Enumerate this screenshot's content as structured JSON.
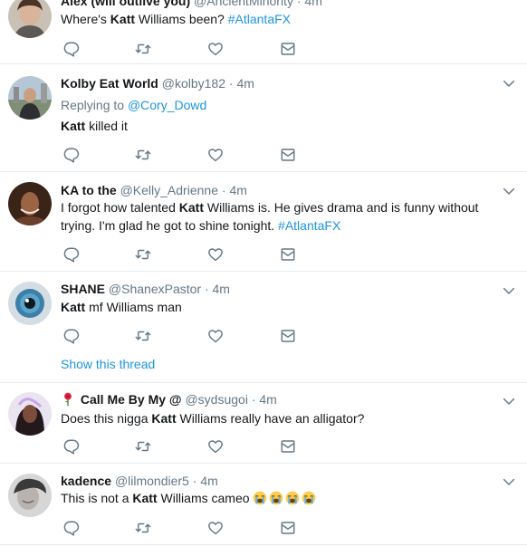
{
  "tweets": [
    {
      "name": "Alex (will outlive you)",
      "handle": "@AncientMinority",
      "time": "4m",
      "pre": "Where's ",
      "bold": "Katt",
      "post": " Williams been? ",
      "hashtag": "#AtlantaFX"
    },
    {
      "name": "Kolby Eat World",
      "handle": "@kolby182",
      "time": "4m",
      "replying_label": "Replying to",
      "replying_handle": "@Cory_Dowd",
      "bold": "Katt",
      "post": " killed it"
    },
    {
      "name": "KA to the",
      "handle": "@Kelly_Adrienne",
      "time": "4m",
      "pre": "I forgot how talented ",
      "bold": "Katt",
      "post": " Williams is. He gives drama and is funny without trying. I'm glad he got to shine tonight. ",
      "hashtag": "#AtlantaFX"
    },
    {
      "name": "SHANE",
      "handle": "@ShanexPastor",
      "time": "4m",
      "bold": "Katt",
      "post": " mf Williams man",
      "show_thread": "Show this thread"
    },
    {
      "name": "Call Me By My @",
      "name_emoji": "rose-emoji",
      "handle": "@sydsugoi",
      "time": "4m",
      "pre": "Does this nigga ",
      "bold": "Katt",
      "post": " Williams really have an alligator?"
    },
    {
      "name": "kadence",
      "handle": "@lilmondier5",
      "time": "4m",
      "pre": "This is not a ",
      "bold": "Katt",
      "post": " Williams cameo ",
      "trailing_emoji": "loudly-crying-face-emoji",
      "trailing_emoji_count": 4
    }
  ],
  "separator": "·",
  "icons": {
    "reply": "reply-icon",
    "retweet": "retweet-icon",
    "like": "heart-icon",
    "dm": "envelope-icon",
    "caret": "chevron-down-icon"
  },
  "colors": {
    "link": "#1b95e0",
    "secondary": "#657786",
    "primary": "#14171a",
    "divider": "#e6ecf0"
  }
}
